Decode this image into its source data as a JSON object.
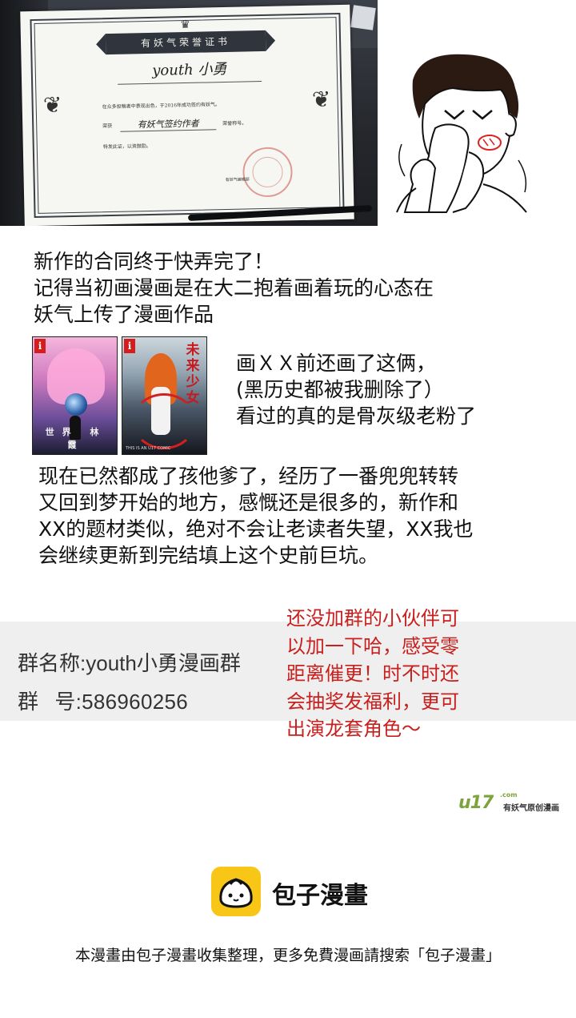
{
  "certificate": {
    "banner_title": "有妖气荣誉证书",
    "recipient_name": "youth 小勇",
    "body_line_1": "在众多投稿者中表现出色，于2016年成功签约有妖气。",
    "body_line_2_prefix": "荣获",
    "work_title": "有妖气签约作者",
    "body_line_2_suffix": "荣誉称号。",
    "body_line_3": "特发此证，以资鼓励。",
    "signature": "有妖气编辑部"
  },
  "paragraph_1": [
    "新作的合同终于快弄完了！",
    "记得当初画漫画是在大二抱着画着玩的心态在",
    "妖气上传了漫画作品"
  ],
  "covers": [
    {
      "badge": "i",
      "title": "世界 林霞"
    },
    {
      "badge": "i",
      "title": "未来少女",
      "small": "THIS IS AN U17 COMIC"
    }
  ],
  "paragraph_2": [
    "画ＸＸ前还画了这俩，",
    "(黑历史都被我删除了）",
    "看过的真的是骨灰级老粉了"
  ],
  "paragraph_3": [
    "现在已然都成了孩他爹了，经历了一番兜兜转转",
    "又回到梦开始的地方，感慨还是很多的，新作和",
    "XX的题材类似，绝对不会让老读者失望，XX我也",
    "会继续更新到完结填上这个史前巨坑。"
  ],
  "group": {
    "name_label": "群名称:",
    "name_value": "youth小勇漫画群",
    "number_label_1": "群",
    "number_label_2": "号:",
    "number_value": "586960256"
  },
  "red_note": [
    "还没加群的小伙伴可",
    "以加一下哈，感受零",
    "距离催更！时不时还",
    "会抽奖发福利，更可",
    "出演龙套角色～"
  ],
  "u17": {
    "logo": "u17",
    "domain_suffix": ".com",
    "slogan": "有妖气原创漫画"
  },
  "brand": {
    "name": "包子漫畫",
    "footer": "本漫畫由包子漫畫收集整理，更多免費漫画請搜索「包子漫畫」"
  },
  "colors": {
    "accent_red": "#c8201e",
    "u17_green": "#7da43a",
    "brand_yellow": "#f7c616",
    "group_bar_bg": "#efefef"
  }
}
